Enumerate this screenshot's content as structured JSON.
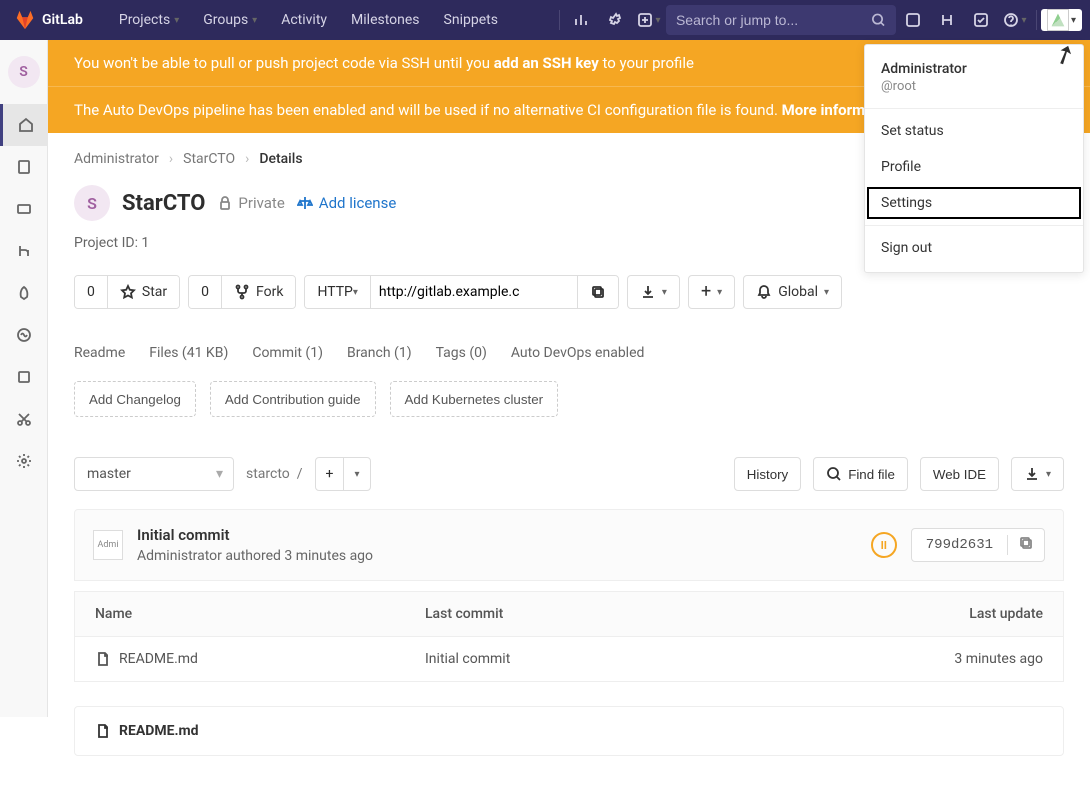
{
  "navbar": {
    "brand": "GitLab",
    "items": [
      "Projects",
      "Groups",
      "Activity",
      "Milestones",
      "Snippets"
    ],
    "search_placeholder": "Search or jump to..."
  },
  "banners": {
    "ssh_pre": "You won't be able to pull or push project code via SSH until you ",
    "ssh_bold": "add an SSH key",
    "ssh_post": " to your profile",
    "devops_pre": "The Auto DevOps pipeline has been enabled and will be used if no alternative CI configuration file is found. ",
    "devops_bold": "More information"
  },
  "breadcrumb": {
    "a": "Administrator",
    "b": "StarCTO",
    "c": "Details"
  },
  "project": {
    "avatar": "S",
    "name": "StarCTO",
    "visibility": "Private",
    "license_label": "Add license",
    "id_label": "Project ID: 1"
  },
  "actions": {
    "star_count": "0",
    "star_label": "Star",
    "fork_count": "0",
    "fork_label": "Fork",
    "proto": "HTTP",
    "clone_url": "http://gitlab.example.c",
    "notif": "Global"
  },
  "meta": {
    "readme": "Readme",
    "files": "Files (41 KB)",
    "commit": "Commit (1)",
    "branch": "Branch (1)",
    "tags": "Tags (0)",
    "devops": "Auto DevOps enabled",
    "add_changelog": "Add Changelog",
    "add_contrib": "Add Contribution guide",
    "add_k8s": "Add Kubernetes cluster"
  },
  "repo": {
    "branch": "master",
    "crumb": "starcto",
    "history": "History",
    "find": "Find file",
    "ide": "Web IDE"
  },
  "commit": {
    "avatar_alt": "Admi",
    "title": "Initial commit",
    "author_line": "Administrator authored 3 minutes ago",
    "ci_symbol": "II",
    "sha": "799d2631"
  },
  "files": {
    "h_name": "Name",
    "h_last": "Last commit",
    "h_update": "Last update",
    "rows": [
      {
        "name": "README.md",
        "last": "Initial commit",
        "update": "3 minutes ago"
      }
    ],
    "readme_title": "README.md"
  },
  "leftrail": {
    "avatar": "S"
  },
  "user_menu": {
    "name": "Administrator",
    "username": "@root",
    "status": "Set status",
    "profile": "Profile",
    "settings": "Settings",
    "signout": "Sign out"
  }
}
